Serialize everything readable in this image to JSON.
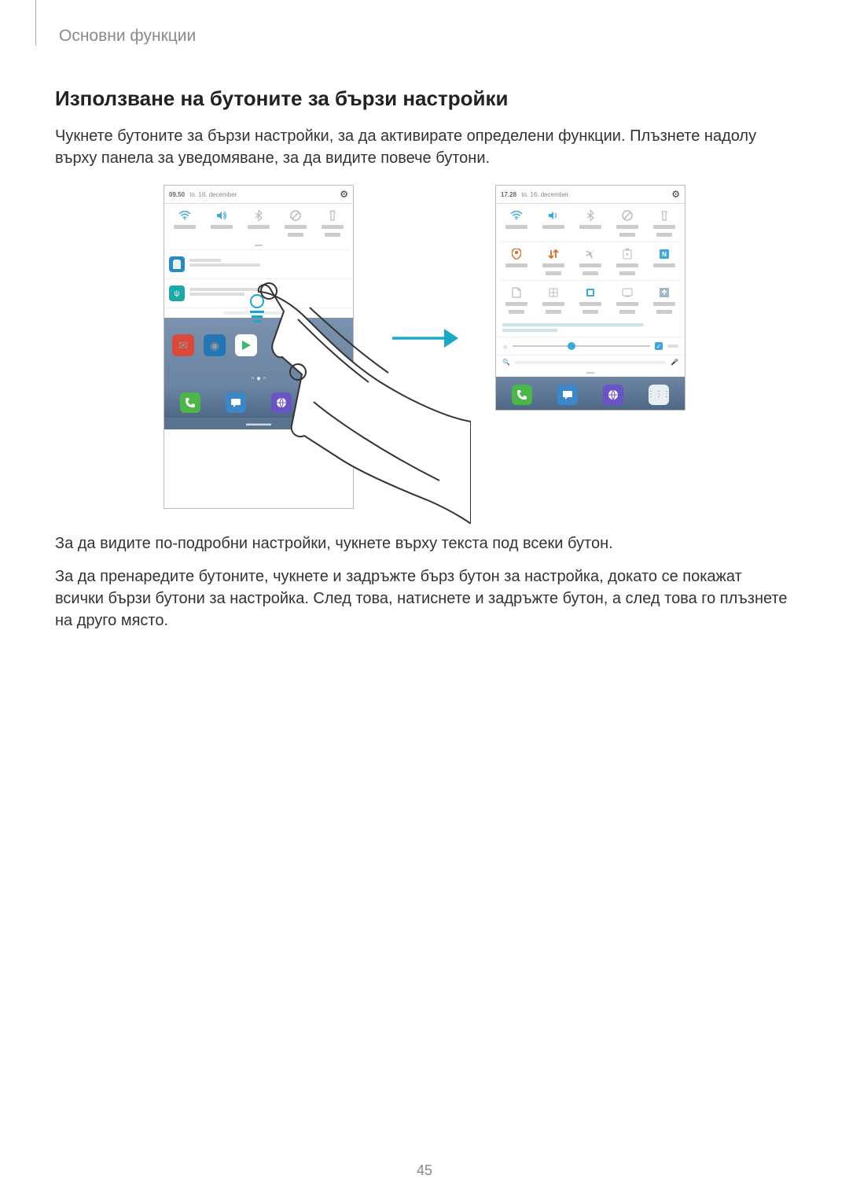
{
  "header": {
    "breadcrumb": "Основни функции"
  },
  "section": {
    "title": "Използване на бутоните за бързи настройки"
  },
  "para1": "Чукнете бутоните за бързи настройки, за да активирате определени функции. Плъзнете надолу върху панела за уведомяване, за да видите повече бутони.",
  "para2": "За да видите по-подробни настройки, чукнете върху текста под всеки бутон.",
  "para3": "За да пренаредите бутоните, чукнете и задръжте бърз бутон за настройка, докато се покажат всички бързи бутони за настройка. След това, натиснете и задръжте бутон, а след това го плъзнете на друго място.",
  "page_number": "45",
  "phone_left": {
    "time": "09.50",
    "date": "to. 16. december",
    "settings_icon": "gear"
  },
  "phone_right": {
    "time": "17.28",
    "date": "to. 16. december",
    "settings_icon": "gear"
  },
  "icons": {
    "wifi": "wifi",
    "sound": "sound",
    "bluetooth": "bluetooth",
    "dnd": "do-not-disturb",
    "flashlight": "flashlight",
    "location": "location",
    "mobiledata": "mobile-data",
    "airplane": "airplane",
    "powersave": "power-save",
    "nfc": "nfc",
    "file": "file",
    "grid": "grid",
    "card": "card",
    "cast": "cast",
    "upload": "upload",
    "phone_app": "phone",
    "messages_app": "messages",
    "browser_app": "browser",
    "apps_app": "apps",
    "mail_app": "mail",
    "camera_app": "camera",
    "play_app": "play",
    "search": "search",
    "mic": "mic",
    "brightness": "brightness",
    "auto_check": "✓"
  }
}
